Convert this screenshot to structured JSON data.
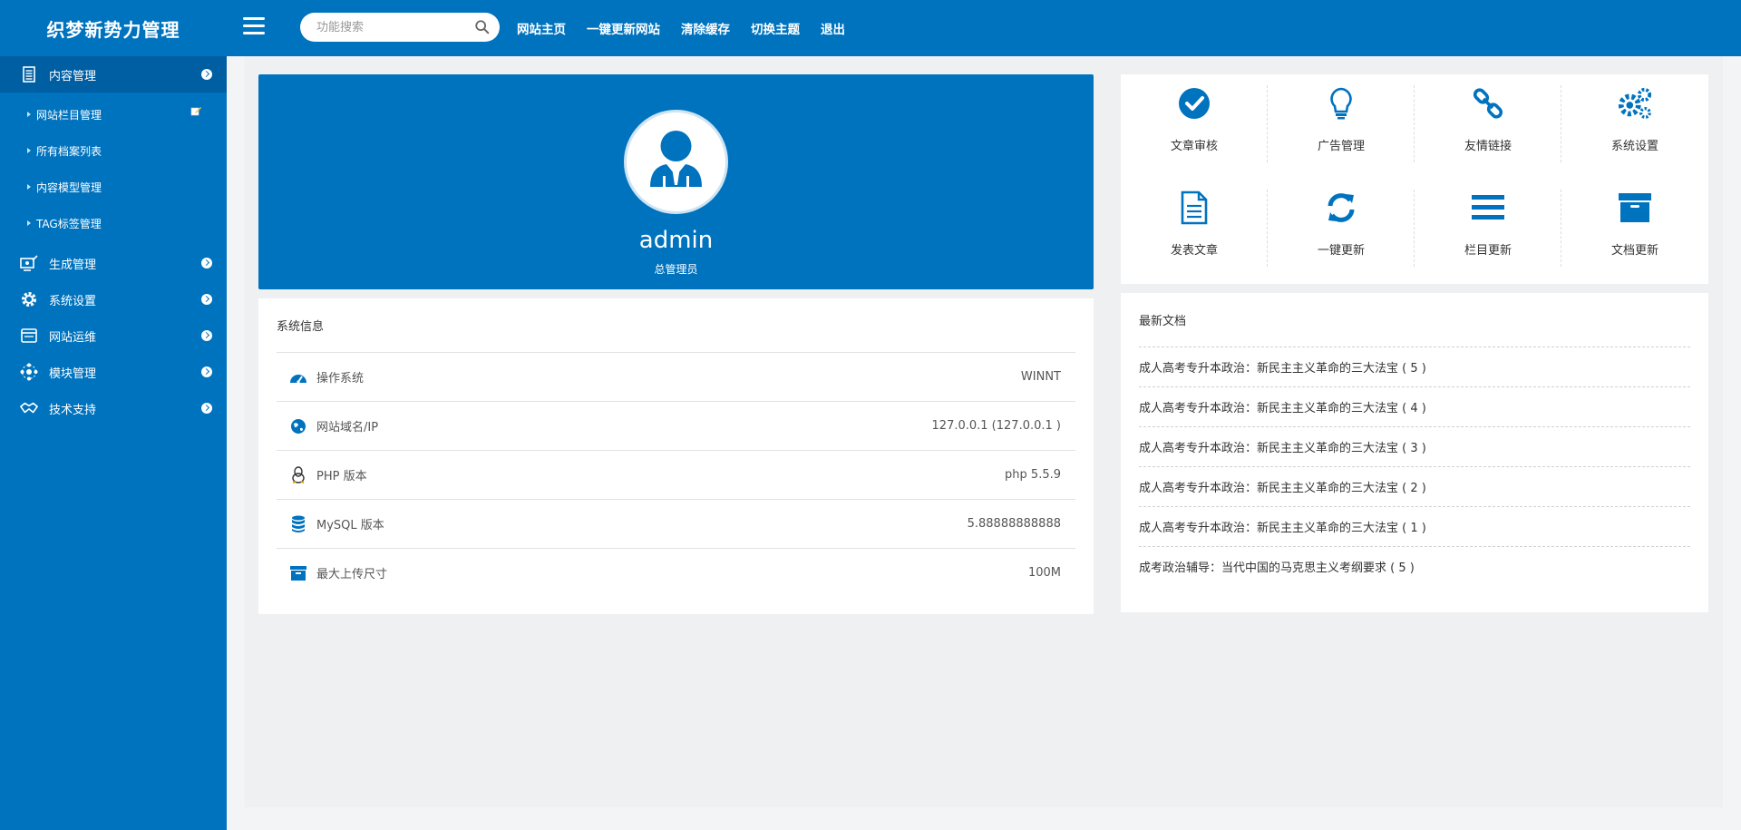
{
  "app": {
    "title": "织梦新势力管理"
  },
  "header": {
    "search_placeholder": "功能搜索",
    "nav": [
      "网站主页",
      "一键更新网站",
      "清除缓存",
      "切换主题",
      "退出"
    ]
  },
  "sidebar": {
    "items": [
      {
        "label": "内容管理",
        "icon": "document-icon",
        "active": true,
        "children": [
          "网站栏目管理",
          "所有档案列表",
          "内容模型管理",
          "TAG标签管理"
        ]
      },
      {
        "label": "生成管理",
        "icon": "generate-icon"
      },
      {
        "label": "系统设置",
        "icon": "gear-icon"
      },
      {
        "label": "网站运维",
        "icon": "window-icon"
      },
      {
        "label": "模块管理",
        "icon": "modules-icon"
      },
      {
        "label": "技术支持",
        "icon": "handshake-icon"
      }
    ]
  },
  "profile": {
    "username": "admin",
    "role": "总管理员"
  },
  "quick_actions": [
    {
      "label": "文章审核",
      "icon": "check-circle-icon"
    },
    {
      "label": "广告管理",
      "icon": "lightbulb-icon"
    },
    {
      "label": "友情链接",
      "icon": "link-icon"
    },
    {
      "label": "系统设置",
      "icon": "gears-icon"
    },
    {
      "label": "发表文章",
      "icon": "file-text-icon"
    },
    {
      "label": "一键更新",
      "icon": "refresh-icon"
    },
    {
      "label": "栏目更新",
      "icon": "bars-icon"
    },
    {
      "label": "文档更新",
      "icon": "archive-icon"
    }
  ],
  "system_info": {
    "title": "系统信息",
    "rows": [
      {
        "label": "操作系统",
        "value": "WINNT",
        "icon": "dashboard-icon"
      },
      {
        "label": "网站域名/IP",
        "value": "127.0.0.1 (127.0.0.1 )",
        "icon": "globe-icon"
      },
      {
        "label": "PHP 版本",
        "value": "php 5.5.9",
        "icon": "linux-icon"
      },
      {
        "label": "MySQL 版本",
        "value": "5.88888888888",
        "icon": "database-icon"
      },
      {
        "label": "最大上传尺寸",
        "value": "100M",
        "icon": "archive-box-icon"
      }
    ]
  },
  "latest_docs": {
    "title": "最新文档",
    "items": [
      "成人高考专升本政治：新民主主义革命的三大法宝 ( 5 )",
      "成人高考专升本政治：新民主主义革命的三大法宝 ( 4 )",
      "成人高考专升本政治：新民主主义革命的三大法宝 ( 3 )",
      "成人高考专升本政治：新民主主义革命的三大法宝 ( 2 )",
      "成人高考专升本政治：新民主主义革命的三大法宝 ( 1 )",
      "成考政治辅导：当代中国的马克思主义考纲要求 ( 5 )"
    ]
  },
  "colors": {
    "primary": "#0073bf",
    "active": "#005ea3",
    "background": "#f3f4f5"
  }
}
